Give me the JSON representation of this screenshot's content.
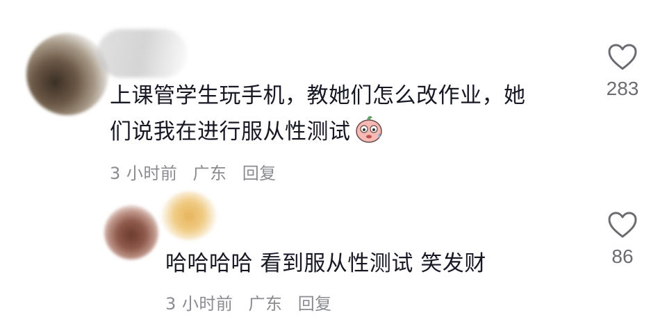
{
  "comments": [
    {
      "text_line1": "上课管学生玩手机，教她们怎么改作业，她",
      "text_line2": "们说我在进行服从性测试",
      "emoji": "sweating-face-emoji",
      "time": "3 小时前",
      "location": "广东",
      "reply_label": "回复",
      "likes": "283",
      "like_icon": "heart-outline-icon"
    },
    {
      "text_line1": "哈哈哈哈 看到服从性测试 笑发财",
      "time": "3 小时前",
      "location": "广东",
      "reply_label": "回复",
      "likes": "86",
      "like_icon": "heart-outline-icon"
    }
  ]
}
